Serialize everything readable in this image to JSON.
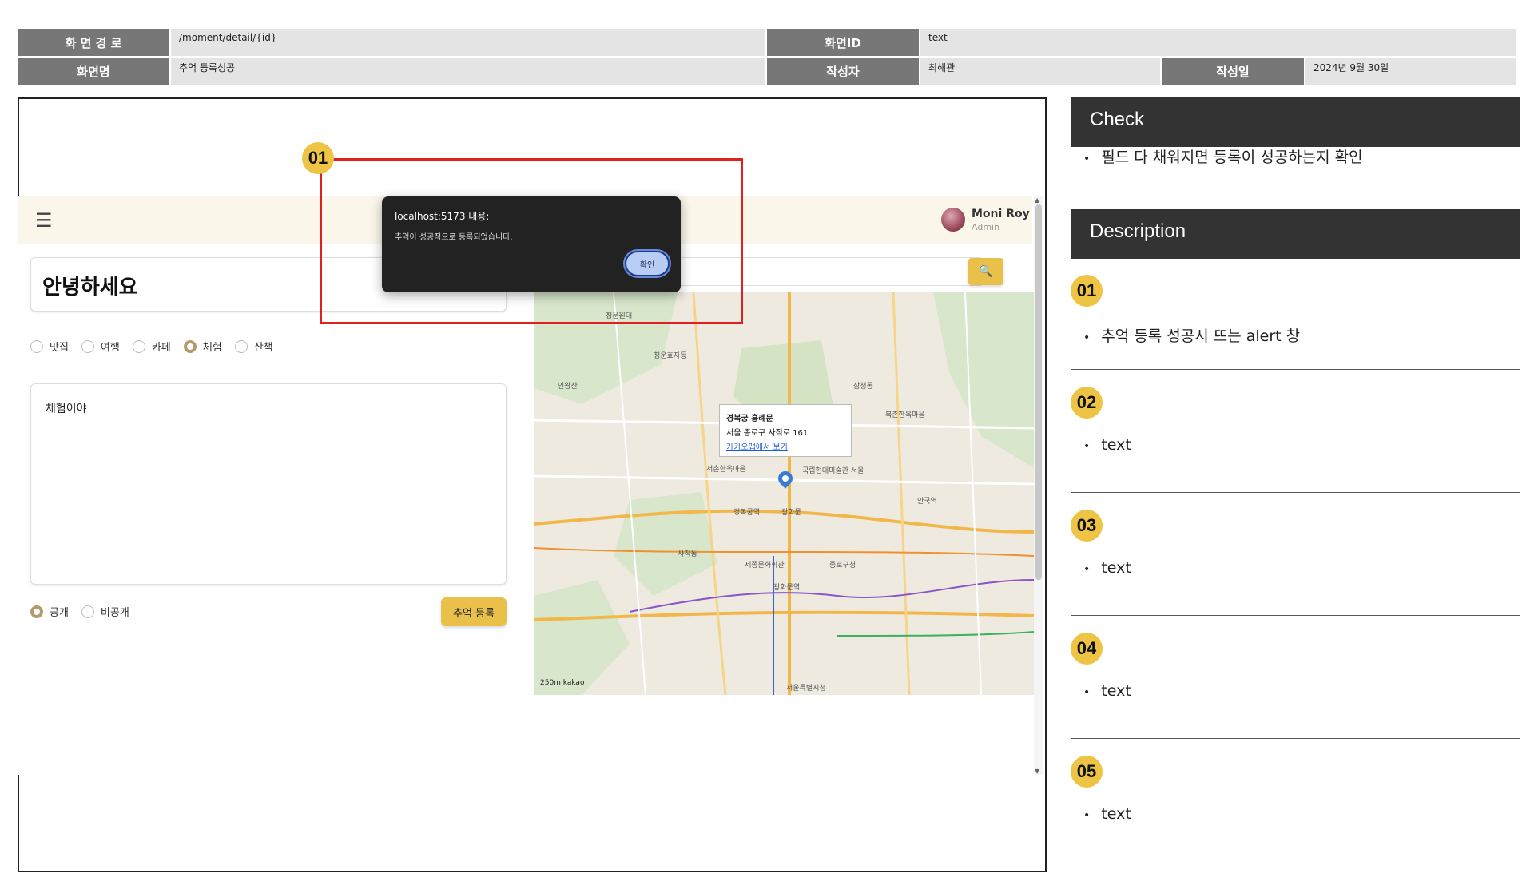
{
  "spec": {
    "path_label": "화 면 경 로",
    "path_value": "/moment/detail/{id}",
    "screen_id_label": "화면ID",
    "screen_id_value": "text",
    "screen_name_label": "화면명",
    "screen_name_value": "추억 등록성공",
    "author_label": "작성자",
    "author_value": "최해관",
    "date_label": "작성일",
    "date_value": "2024년 9월 30일"
  },
  "app": {
    "user_name": "Moni Roy",
    "user_role": "Admin",
    "title_value": "안녕하세요",
    "categories": [
      "맛집",
      "여행",
      "카페",
      "체험",
      "산책"
    ],
    "content_value": "체험이야",
    "visibility": [
      "공개",
      "비공개"
    ],
    "submit_label": "추억 등록",
    "map": {
      "popup_title": "경복궁 흥례문",
      "popup_address": "서울 종로구 사직로 161",
      "popup_link": "카카오맵에서 보기",
      "scale": "250m kakao",
      "labels": [
        "정문원대",
        "청운효자동",
        "사직동",
        "경복궁역",
        "광화문역",
        "종로구청",
        "서울특별시청",
        "안국역",
        "북촌한옥마을",
        "서촌한옥마을",
        "국립현대미술관 서울",
        "광화문",
        "세종문화회관",
        "인왕산",
        "삼청동"
      ]
    }
  },
  "alert": {
    "title": "localhost:5173 내용:",
    "message": "추억이 성공적으로 등록되었습니다.",
    "ok_label": "확인"
  },
  "badges": [
    "01",
    "02",
    "03",
    "04",
    "05"
  ],
  "panel": {
    "check_title": "Check",
    "check_item": "필드 다 채워지면 등록이 성공하는지 확인",
    "desc_title": "Description",
    "desc_items": [
      "추억 등록 성공시 뜨는 alert 창",
      "text",
      "text",
      "text",
      "text"
    ]
  },
  "colors": {
    "accent": "#e8c04a",
    "badge": "#edc444",
    "highlight": "#e02020",
    "header_dark": "#333333",
    "spec_label": "#777777"
  }
}
